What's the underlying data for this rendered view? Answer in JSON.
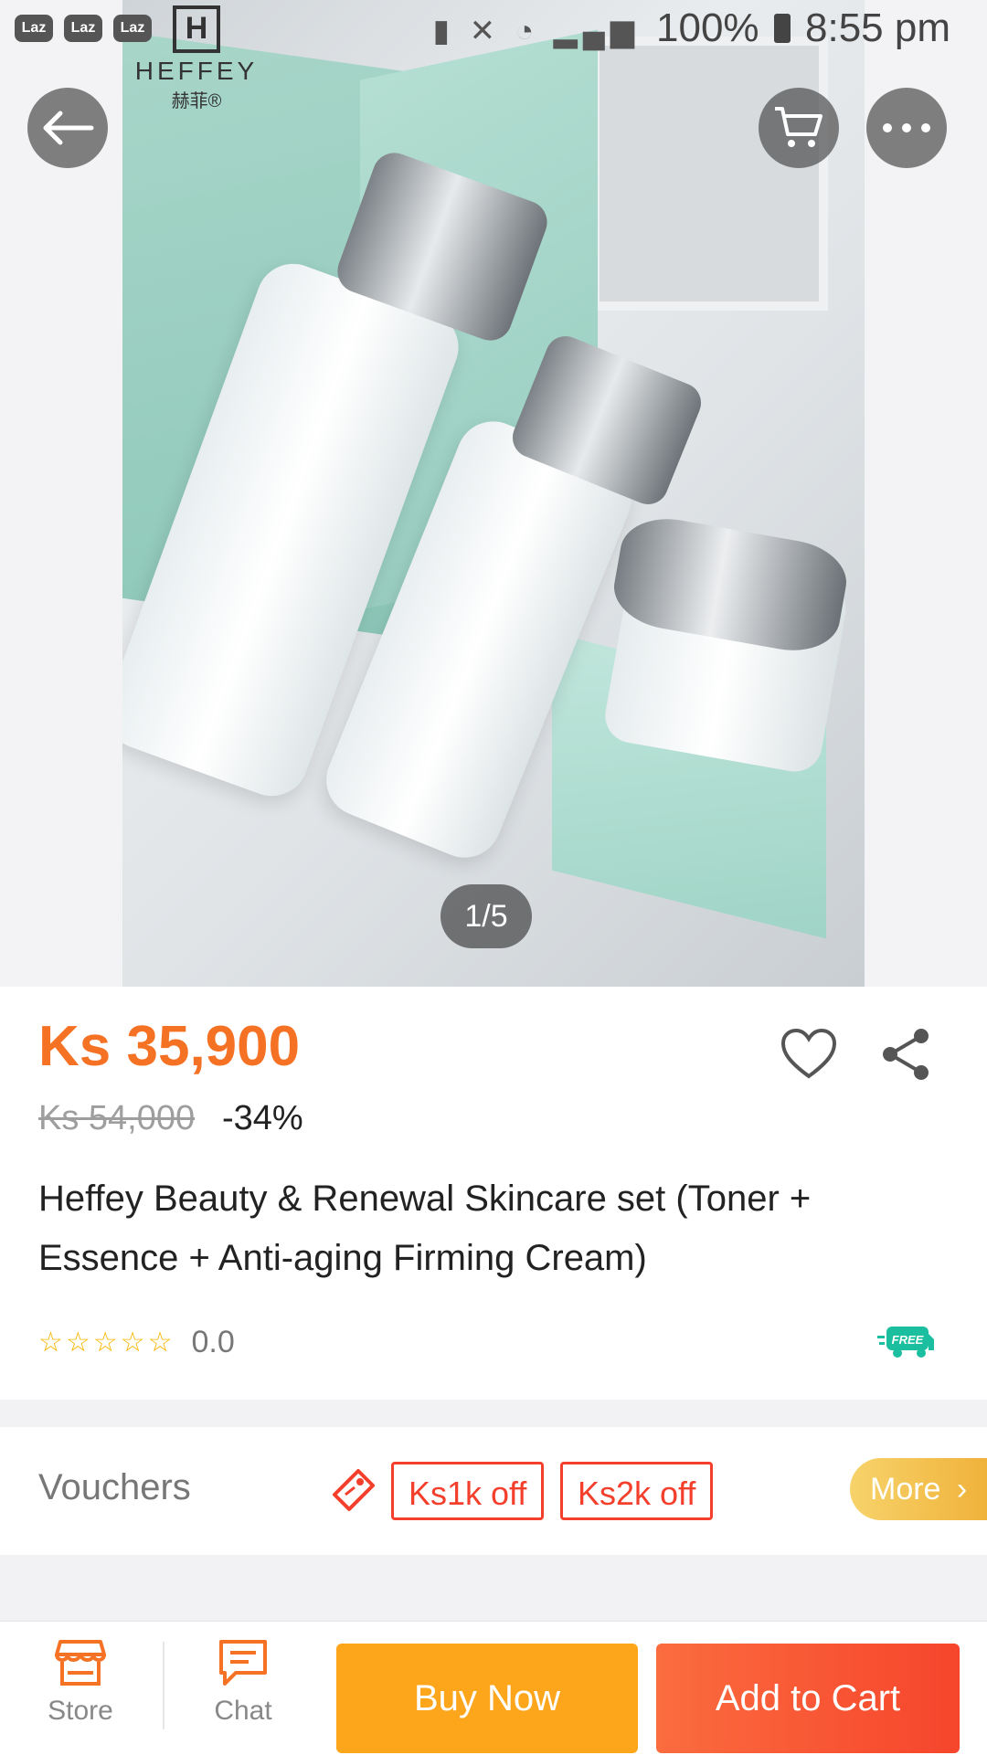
{
  "status_bar": {
    "notification_icons": [
      "Laz",
      "Laz",
      "Laz"
    ],
    "battery": "100%",
    "time": "8:55 pm"
  },
  "gallery": {
    "page_indicator": "1/5",
    "brand_logo": {
      "name": "HEFFEY",
      "sub": "赫菲®"
    }
  },
  "product": {
    "price": "Ks 35,900",
    "original_price": "Ks 54,000",
    "discount": "-34%",
    "title": "Heffey Beauty & Renewal Skincare set (Toner + Essence + Anti-aging Firming Cream)",
    "stars": "☆☆☆☆☆",
    "rating": "0.0",
    "free_badge": "FREE"
  },
  "vouchers": {
    "label": "Vouchers",
    "items": [
      "Ks1k off",
      "Ks2k off"
    ],
    "more": "More"
  },
  "bottom_bar": {
    "store": "Store",
    "chat": "Chat",
    "buy_now": "Buy Now",
    "add_to_cart": "Add to Cart"
  },
  "colors": {
    "price": "#f57224",
    "voucher": "#f33f2b",
    "buy_now": "#fda61c",
    "add_to_cart": "#f6452c",
    "free_badge": "#1bbf9f"
  }
}
